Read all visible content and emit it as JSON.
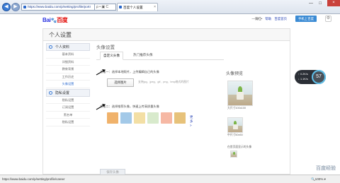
{
  "browser": {
    "url": "https://www.baidu.com/p/setting/profile/portr",
    "url_tools": "ρ • ▣ C",
    "tab_title": "百度个人设置",
    "tab_close": "×",
    "window_controls": [
      "—",
      "□"
    ],
    "window_close": "×",
    "status_url": "https://www.baidu.com/p/setting/profile/career",
    "zoom": "🔍100% ▾"
  },
  "site": {
    "logo_bai": "Bai",
    "logo_paw": "🐾",
    "logo_du": "百度",
    "top_user": "—骑红•",
    "top_links": [
      "帮助",
      "百度首页"
    ],
    "phone_button": "手机上百度"
  },
  "page": {
    "heading": "个人设置"
  },
  "sidebar": {
    "group1": "个人资料",
    "group1_items": [
      "基本资料",
      "详细资料",
      "教育背景",
      "工作历史",
      "头像设置"
    ],
    "group2": "隐私设置",
    "group2_items": [
      "隐私设置",
      "订阅设置",
      "黑名单",
      "隐私设置"
    ]
  },
  "main": {
    "section_title": "头像设置",
    "tabs": [
      "自定义头像",
      "热门推荐头像"
    ],
    "option1": "方法一：选择本地照片，上传编辑自己的头像",
    "upload_button": "选择图片",
    "upload_hint": "支持jpg、jpeg、gif、png、bmp格式的图片",
    "option2": "方法二：选择推荐头像，快速上传高质量头像",
    "more_link": "更多>",
    "save_button": "保存头像",
    "avatar_colors": [
      "#f0b26b",
      "#a3c9e8",
      "#f3dfa5",
      "#d8eacc",
      "#f6b8a4",
      "#e7c27a"
    ]
  },
  "preview": {
    "title": "头像预览",
    "caption_big": "大尺寸100x100",
    "caption_mid": "中尺寸50x50",
    "caption_small": "在首页面显示的头像"
  },
  "widget": {
    "up": "↑ 0.2K/s",
    "down": "↓ 1.1K/s",
    "percent": "57"
  },
  "watermark": "百度经验"
}
